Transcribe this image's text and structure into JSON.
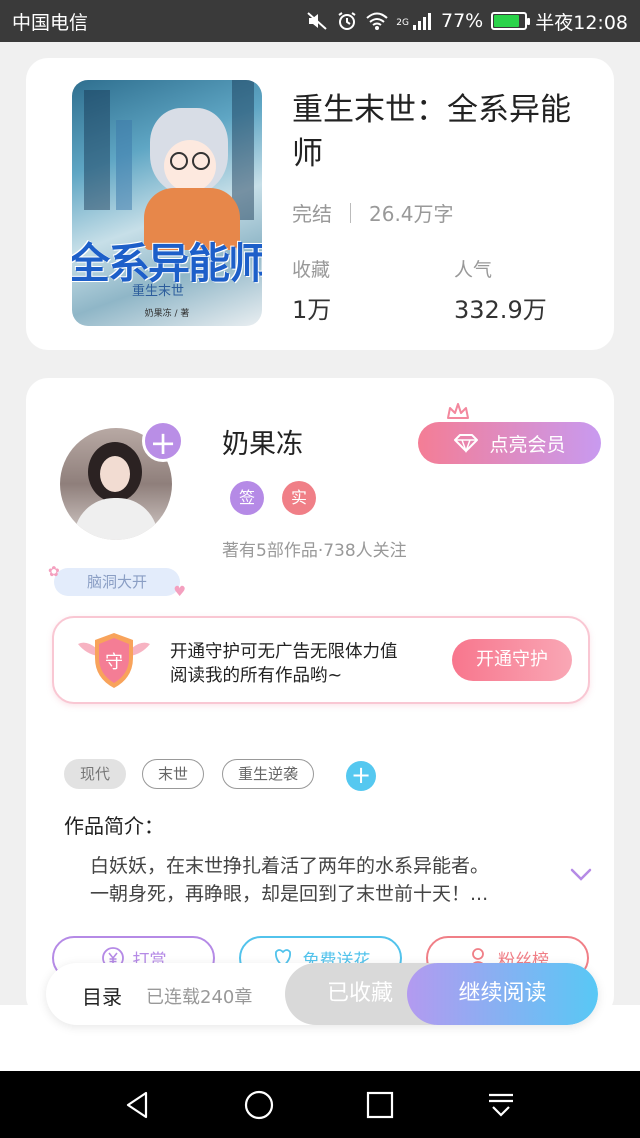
{
  "status_bar": {
    "carrier": "中国电信",
    "network": "2G",
    "battery": "77%",
    "battery_level": 0.77,
    "time": "半夜12:08"
  },
  "book": {
    "title": "重生末世：全系异能师",
    "status": "完结",
    "word_count": "26.4万字",
    "stats": [
      {
        "label": "收藏",
        "value": "1万"
      },
      {
        "label": "人气",
        "value": "332.9万"
      }
    ],
    "cover": {
      "big_title": "全系异能师",
      "subtitle": "重生末世",
      "author": "奶果冻 / 著"
    }
  },
  "author": {
    "name": "奶果冻",
    "follow_icon": "plus-icon",
    "badge": "脑洞大开",
    "tags": [
      {
        "label": "签",
        "color": "#b58ae6"
      },
      {
        "label": "实",
        "color": "#f07f87"
      }
    ],
    "works_info": "著有5部作品·738人关注",
    "vip_button": "点亮会员"
  },
  "guard": {
    "shield_char": "守",
    "line1": "开通守护可无广告无限体力值",
    "line2": "阅读我的所有作品哟~",
    "button": "开通守护"
  },
  "genres": [
    "现代",
    "末世",
    "重生逆袭"
  ],
  "intro": {
    "label": "作品简介：",
    "line1": "白妖妖，在末世挣扎着活了两年的水系异能者。",
    "line2": "一朝身死，再睁眼，却是回到了末世前十天！..."
  },
  "actions": [
    {
      "label": "打赏",
      "icon": "yen-icon",
      "color": "#b58ae6"
    },
    {
      "label": "免费送花",
      "icon": "flower-icon",
      "color": "#52c3ec"
    },
    {
      "label": "粉丝榜",
      "icon": "user-icon",
      "color": "#f07f87"
    }
  ],
  "bottom_bar": {
    "catalog": "目录",
    "chapter_count": "已连载240章",
    "collected": "已收藏",
    "continue_read": "继续阅读"
  },
  "colors": {
    "accent_purple": "#b58ae6",
    "accent_blue": "#58c8f5",
    "accent_pink": "#f47d95"
  }
}
